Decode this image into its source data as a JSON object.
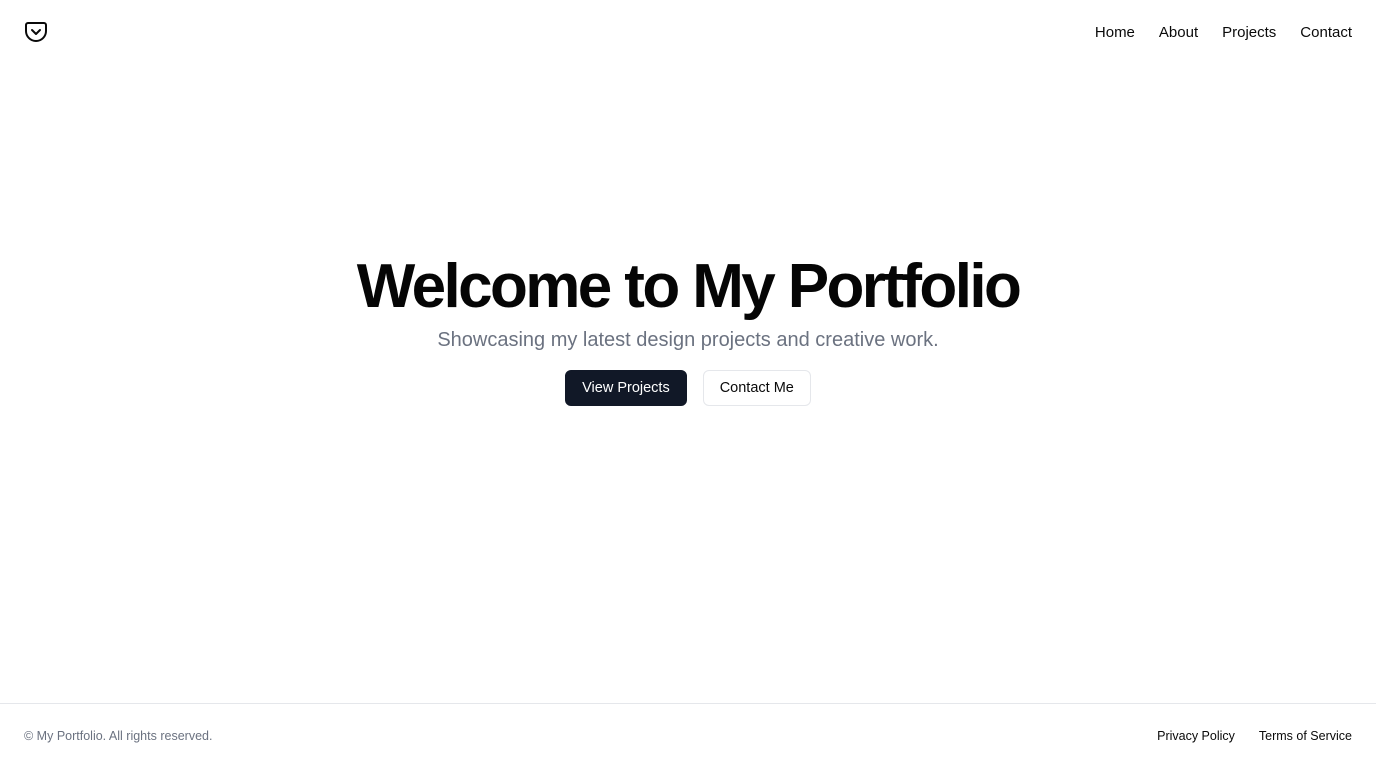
{
  "header": {
    "logo_icon": "pocket-shield-icon",
    "nav": {
      "home": "Home",
      "about": "About",
      "projects": "Projects",
      "contact": "Contact"
    }
  },
  "hero": {
    "title": "Welcome to My Portfolio",
    "subtitle": "Showcasing my latest design projects and creative work.",
    "primary_button": "View Projects",
    "secondary_button": "Contact Me"
  },
  "footer": {
    "copyright": "© My Portfolio. All rights reserved.",
    "links": {
      "privacy": "Privacy Policy",
      "terms": "Terms of Service"
    }
  },
  "colors": {
    "primary_button_bg": "#111827",
    "subtitle_text": "#6b7280",
    "border": "#e5e7eb"
  }
}
